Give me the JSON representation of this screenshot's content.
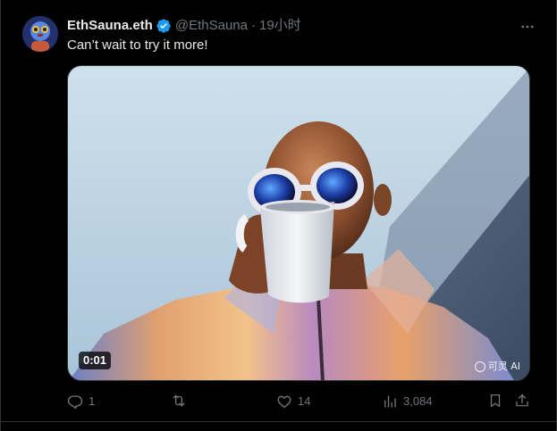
{
  "author": {
    "display_name": "EthSauna.eth",
    "handle": "@EthSauna",
    "separator": "·",
    "time": "19小时"
  },
  "tweet": {
    "text": "Can’t wait to try it more!"
  },
  "media": {
    "duration": "0:01",
    "watermark": "可灵 AI"
  },
  "actions": {
    "reply_count": "1",
    "retweet_count": "",
    "like_count": "14",
    "view_count": "3,084"
  },
  "icons": {
    "verified": "verified-badge-icon",
    "more": "more-icon",
    "reply": "reply-icon",
    "retweet": "retweet-icon",
    "like": "like-icon",
    "views": "views-icon",
    "bookmark": "bookmark-icon",
    "share": "share-icon"
  },
  "colors": {
    "background": "#000000",
    "text_primary": "#e7e9ea",
    "text_secondary": "#71767b",
    "border": "#2f3336",
    "verified_blue": "#1d9bf0"
  }
}
